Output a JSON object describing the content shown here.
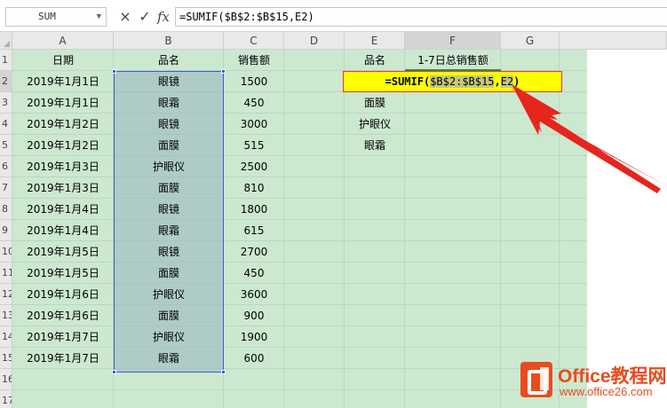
{
  "formula_bar": {
    "name_box": "SUM",
    "cancel_icon": "×",
    "enter_icon": "✓",
    "fx_label": "fx",
    "formula": "=SUMIF($B$2:$B$15,E2)"
  },
  "columns": [
    "A",
    "B",
    "C",
    "D",
    "E",
    "F",
    "G"
  ],
  "rows": [
    "1",
    "2",
    "3",
    "4",
    "5",
    "6",
    "7",
    "8",
    "9",
    "10",
    "11",
    "12",
    "13",
    "14",
    "15",
    "16",
    "17"
  ],
  "headers": {
    "a": "日期",
    "b": "品名",
    "c": "销售额",
    "e": "品名",
    "f": "1-7日总销售额"
  },
  "data": [
    {
      "date": "2019年1月1日",
      "name": "眼镜",
      "sales": "1500"
    },
    {
      "date": "2019年1月1日",
      "name": "眼霜",
      "sales": "450"
    },
    {
      "date": "2019年1月2日",
      "name": "眼镜",
      "sales": "3000"
    },
    {
      "date": "2019年1月2日",
      "name": "面膜",
      "sales": "515"
    },
    {
      "date": "2019年1月3日",
      "name": "护眼仪",
      "sales": "2500"
    },
    {
      "date": "2019年1月3日",
      "name": "面膜",
      "sales": "810"
    },
    {
      "date": "2019年1月4日",
      "name": "眼镜",
      "sales": "1800"
    },
    {
      "date": "2019年1月4日",
      "name": "眼霜",
      "sales": "615"
    },
    {
      "date": "2019年1月5日",
      "name": "眼镜",
      "sales": "2700"
    },
    {
      "date": "2019年1月5日",
      "name": "面膜",
      "sales": "450"
    },
    {
      "date": "2019年1月6日",
      "name": "护眼仪",
      "sales": "3600"
    },
    {
      "date": "2019年1月6日",
      "name": "面膜",
      "sales": "900"
    },
    {
      "date": "2019年1月7日",
      "name": "护眼仪",
      "sales": "1900"
    },
    {
      "date": "2019年1月7日",
      "name": "眼霜",
      "sales": "600"
    }
  ],
  "lookup_items": [
    "面膜",
    "护眼仪",
    "眼霜"
  ],
  "formula_cell": {
    "prefix": "=SUMIF(",
    "ref1": "$B$2:$B$15",
    "sep": ",",
    "ref2": "E2",
    "suffix": ")"
  },
  "watermark": {
    "title": "Office教程网",
    "url": "www.office26.com"
  },
  "colors": {
    "sheet_green": "#cce8cf",
    "formula_yellow": "#ffff00",
    "arrow_red": "#e8241e",
    "range_blue": "#3b5bdb",
    "brand_orange": "#e84c1e"
  }
}
